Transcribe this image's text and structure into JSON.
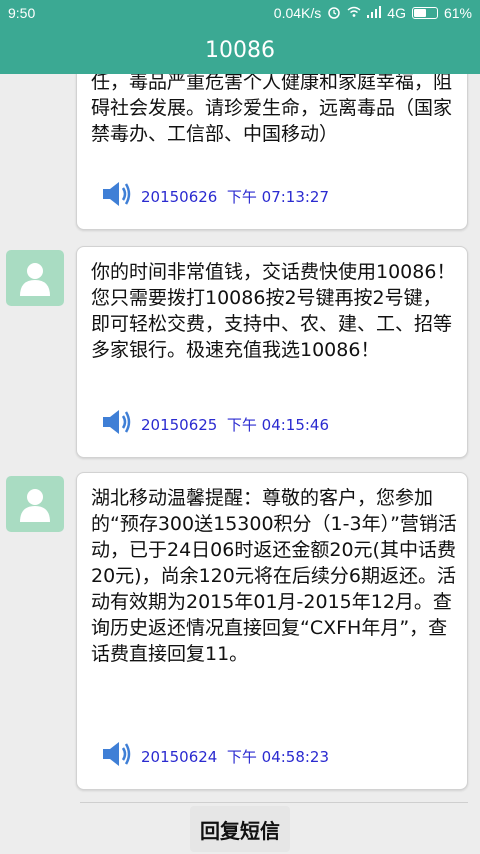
{
  "status_bar": {
    "time": "9:50",
    "speed": "0.04K/s",
    "network": "4G",
    "battery": "61%",
    "battery_level": 0.61,
    "icons": [
      "alarm-icon",
      "wifi-icon",
      "signal-icon",
      "battery-icon"
    ]
  },
  "header": {
    "title": "10086"
  },
  "messages": [
    {
      "text": "任，毒品严重危害个人健康和家庭幸福，阻碍社会发展。请珍爱生命，远离毒品（国家禁毒办、工信部、中国移动）",
      "date": "20150626  下午 07:13:27",
      "has_avatar": false
    },
    {
      "text": "你的时间非常值钱，交话费快使用10086！您只需要拨打10086按2号键再按2号键，即可轻松交费，支持中、农、建、工、招等多家银行。极速充值我选10086！",
      "date": "20150625  下午 04:15:46",
      "has_avatar": true
    },
    {
      "text": "湖北移动温馨提醒：尊敬的客户，您参加的“预存300送15300积分（1-3年）”营销活动，已于24日06时返还金额20元(其中话费20元)，尚余120元将在后续分6期返还。活动有效期为2015年01月-2015年12月。查询历史返还情况直接回复“CXFH年月”，查话费直接回复11。",
      "date": "20150624  下午 04:58:23",
      "has_avatar": true
    }
  ],
  "reply_button": {
    "label": "回复短信"
  },
  "colors": {
    "accent": "#3ba993",
    "date_text": "#2b2bd0",
    "speaker": "#3f7fd6",
    "avatar_bg": "#a9dcc2"
  }
}
